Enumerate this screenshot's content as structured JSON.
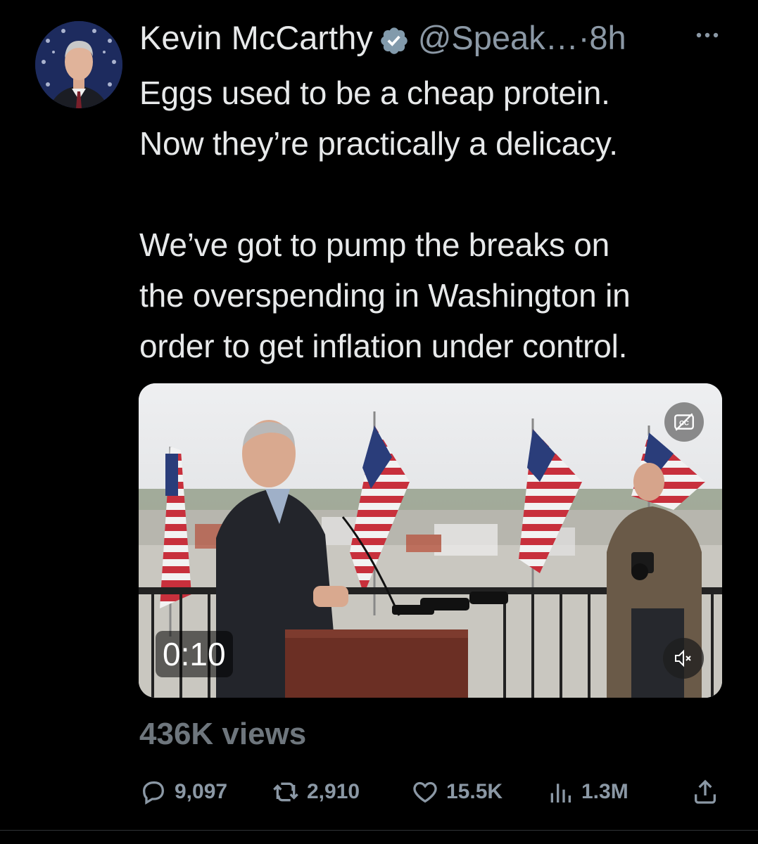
{
  "tweet": {
    "author": {
      "display_name": "Kevin McCarthy",
      "handle": "@Speak…",
      "separator": "·",
      "time": "8h",
      "verified": true
    },
    "text": "Eggs used to be a cheap protein.\nNow they’re practically a delicacy.\n\nWe’ve got to pump the breaks on\nthe overspending in Washington in\norder to get inflation under control.",
    "media": {
      "type": "video",
      "duration": "0:10",
      "captions_icon": "closed-captions-off-icon",
      "mute_icon": "speaker-muted-icon"
    },
    "views": "436K views",
    "actions": {
      "replies": "9,097",
      "retweets": "2,910",
      "likes": "15.5K",
      "analytics": "1.3M"
    }
  },
  "colors": {
    "background": "#000000",
    "text_primary": "#e7e9ea",
    "text_secondary": "#8b98a5",
    "verified_badge": "#829aab"
  }
}
